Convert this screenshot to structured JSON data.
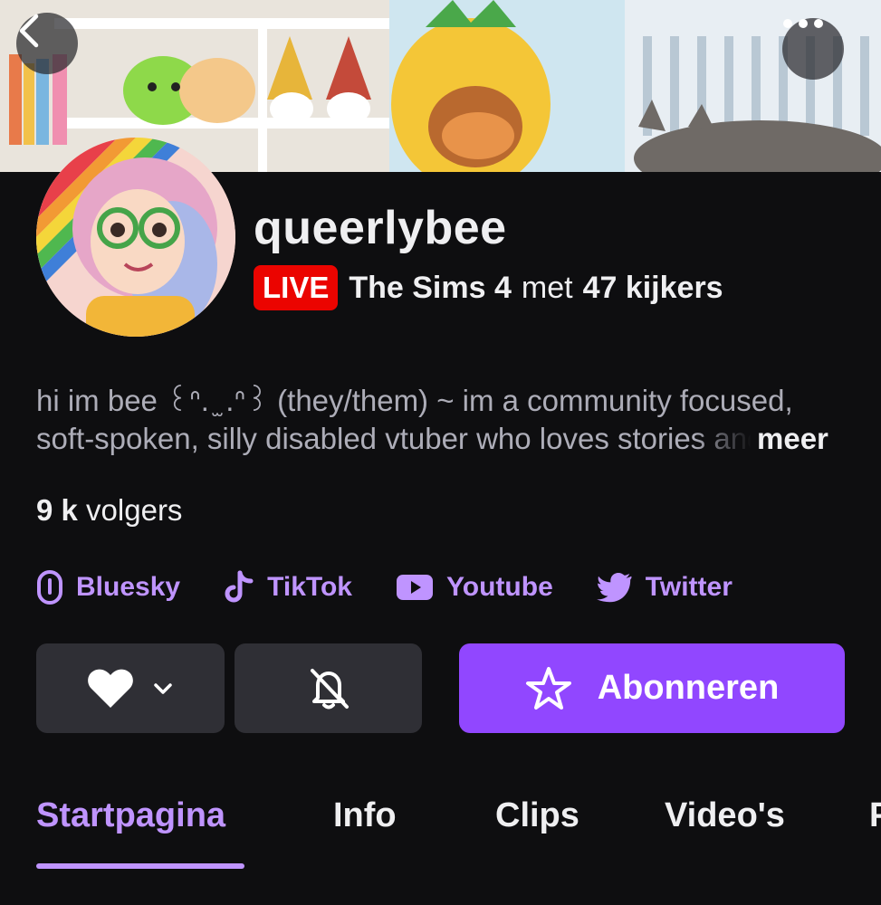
{
  "channel": {
    "name": "queerlybee",
    "live_badge": "LIVE",
    "game": "The Sims 4",
    "met": "met",
    "viewers": "47 kijkers",
    "bio_line1": "hi im bee ꒰ᐢ. ̫ .ᐢ꒱ (they/them) ~ im a community focused,",
    "bio_line2": "soft-spoken, silly disabled vtuber who loves stories and cozy games",
    "bio_more": "meer",
    "followers_count": "9 k",
    "followers_label": "volgers"
  },
  "socials": [
    {
      "label": "Bluesky",
      "icon": "bluesky-icon"
    },
    {
      "label": "TikTok",
      "icon": "tiktok-icon"
    },
    {
      "label": "Youtube",
      "icon": "youtube-icon"
    },
    {
      "label": "Twitter",
      "icon": "twitter-icon"
    }
  ],
  "actions": {
    "subscribe_label": "Abonneren"
  },
  "tabs": [
    {
      "label": "Startpagina",
      "active": true
    },
    {
      "label": "Info",
      "active": false
    },
    {
      "label": "Clips",
      "active": false
    },
    {
      "label": "Video's",
      "active": false
    },
    {
      "label": "P",
      "active": false
    }
  ],
  "colors": {
    "accent": "#bf94ff",
    "subscribe": "#9147ff",
    "live": "#eb0400",
    "background": "#0e0e10"
  }
}
